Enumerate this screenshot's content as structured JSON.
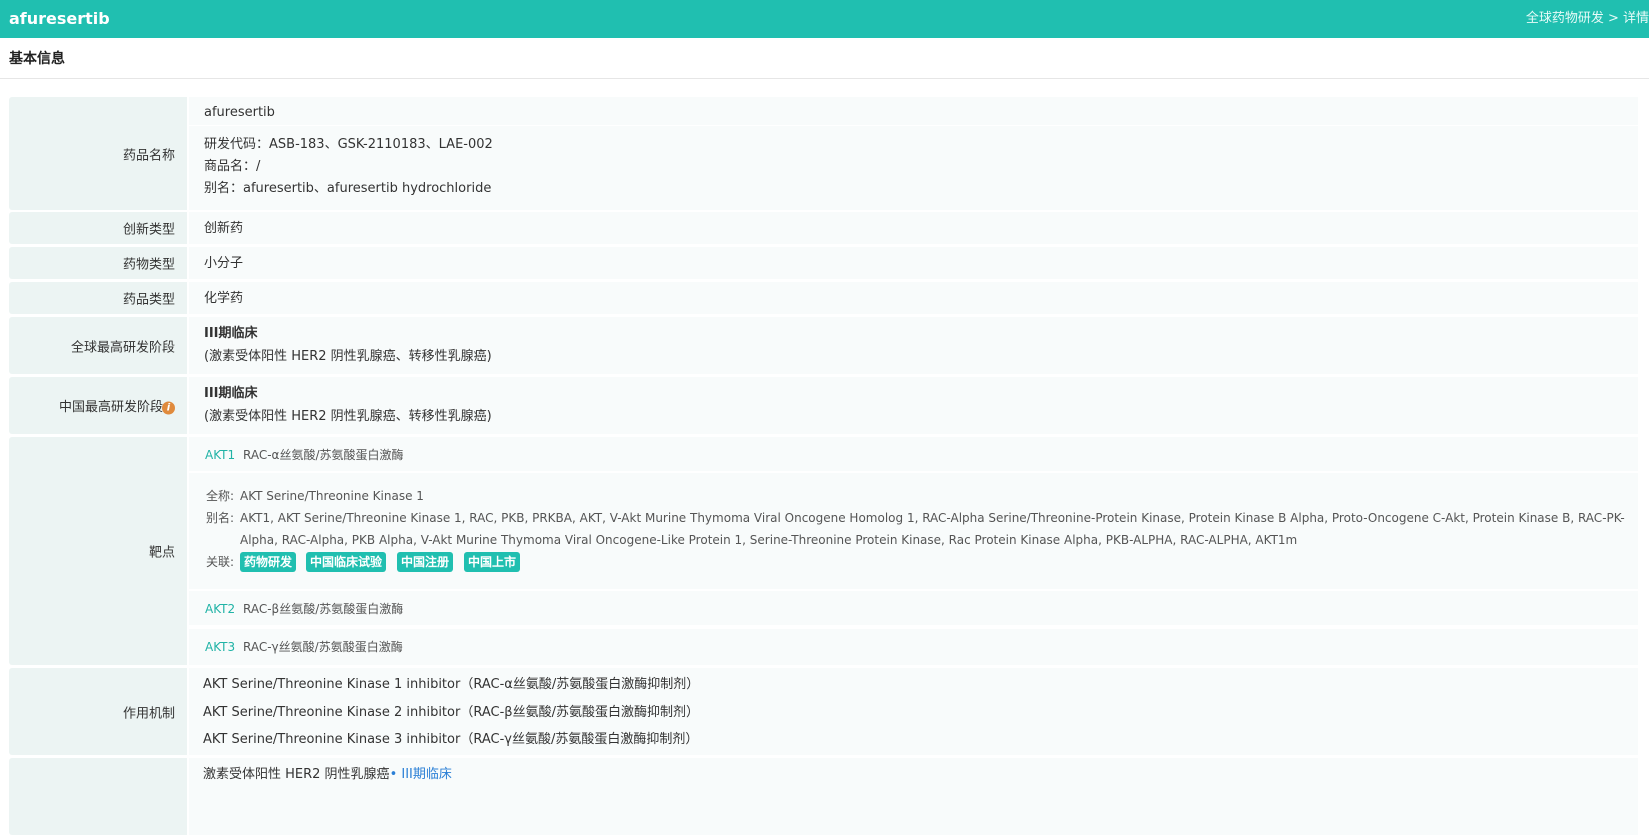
{
  "header": {
    "title": "afuresertib",
    "breadcrumb": "全球药物研发 > 详情"
  },
  "section": {
    "title": "基本信息"
  },
  "drug_name": {
    "label": "药品名称",
    "name": "afuresertib",
    "codes": "研发代码：ASB-183、GSK-2110183、LAE-002",
    "trade": "商品名：/",
    "alias": "别名：afuresertib、afuresertib hydrochloride"
  },
  "innovation": {
    "label": "创新类型",
    "value": "创新药"
  },
  "compound": {
    "label": "药物类型",
    "value": "小分子"
  },
  "product": {
    "label": "药品类型",
    "value": "化学药"
  },
  "global_stage": {
    "label": "全球最高研发阶段",
    "stage": "III期临床",
    "note": "(激素受体阳性 HER2 阴性乳腺癌、转移性乳腺癌)"
  },
  "china_stage": {
    "label": "中国最高研发阶段",
    "icon": "info-icon",
    "stage": "III期临床",
    "note": "(激素受体阳性 HER2 阴性乳腺癌、转移性乳腺癌)"
  },
  "targets": {
    "label": "靶点",
    "items": [
      {
        "code": "AKT1",
        "desc": "RAC-α丝氨酸/苏氨酸蛋白激酶"
      },
      {
        "code": "AKT2",
        "desc": "RAC-β丝氨酸/苏氨酸蛋白激酶"
      },
      {
        "code": "AKT3",
        "desc": "RAC-γ丝氨酸/苏氨酸蛋白激酶"
      }
    ],
    "detail": {
      "fullname_label": "全称:",
      "fullname": "AKT Serine/Threonine Kinase 1",
      "alias_label": "别名:",
      "alias_line1": "AKT1, AKT Serine/Threonine Kinase 1, RAC, PKB, PRKBA, AKT, V-Akt Murine Thymoma Viral Oncogene Homolog 1, RAC-Alpha Serine/Threonine-Protein Kinase, Protein Kinase B Alpha, Proto-Oncogene C-Akt, Protein Kinase B, RAC-PK-",
      "alias_line2": "Alpha, RAC-Alpha, PKB Alpha, V-Akt Murine Thymoma Viral Oncogene-Like Protein 1, Serine-Threonine Protein Kinase, Rac Protein Kinase Alpha, PKB-ALPHA, RAC-ALPHA, AKT1m",
      "related_label": "关联:",
      "tags": [
        "药物研发",
        "中国临床试验",
        "中国注册",
        "中国上市"
      ]
    }
  },
  "mechanism": {
    "label": "作用机制",
    "items": [
      "AKT Serine/Threonine Kinase 1 inhibitor（RAC-α丝氨酸/苏氨酸蛋白激酶抑制剂）",
      "AKT Serine/Threonine Kinase 2 inhibitor（RAC-β丝氨酸/苏氨酸蛋白激酶抑制剂）",
      "AKT Serine/Threonine Kinase 3 inhibitor（RAC-γ丝氨酸/苏氨酸蛋白激酶抑制剂）"
    ]
  },
  "indication": {
    "text": "激素受体阳性 HER2 阴性乳腺癌",
    "stage": "• III期临床"
  },
  "colors": {
    "accent": "#20bfb0",
    "label_bg": "#ecf4f3",
    "value_bg": "#f8fbfb",
    "link": "#20b3a6",
    "stage_blue": "#2a7fd6"
  }
}
